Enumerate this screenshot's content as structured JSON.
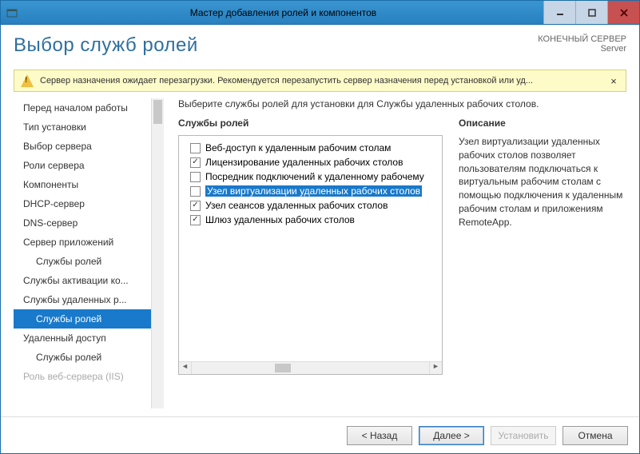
{
  "titlebar": {
    "title": "Мастер добавления ролей и компонентов"
  },
  "header": {
    "page_title": "Выбор служб ролей",
    "dest_label": "КОНЕЧНЫЙ СЕРВЕР",
    "dest_value": "Server"
  },
  "warning": {
    "text": "Сервер назначения ожидает перезагрузки. Рекомендуется перезапустить сервер назначения перед установкой или уд...",
    "close": "×"
  },
  "sidebar": {
    "items": [
      {
        "label": "Перед началом работы",
        "indent": false
      },
      {
        "label": "Тип установки",
        "indent": false
      },
      {
        "label": "Выбор сервера",
        "indent": false
      },
      {
        "label": "Роли сервера",
        "indent": false
      },
      {
        "label": "Компоненты",
        "indent": false
      },
      {
        "label": "DHCP-сервер",
        "indent": false
      },
      {
        "label": "DNS-сервер",
        "indent": false
      },
      {
        "label": "Сервер приложений",
        "indent": false
      },
      {
        "label": "Службы ролей",
        "indent": true
      },
      {
        "label": "Службы активации ко...",
        "indent": false
      },
      {
        "label": "Службы удаленных р...",
        "indent": false
      },
      {
        "label": "Службы ролей",
        "indent": true,
        "selected": true
      },
      {
        "label": "Удаленный доступ",
        "indent": false
      },
      {
        "label": "Службы ролей",
        "indent": true
      },
      {
        "label": "Роль веб-сервера (IIS)",
        "indent": false,
        "disabled": true
      }
    ]
  },
  "main": {
    "instruction": "Выберите службы ролей для установки для Службы удаленных рабочих столов.",
    "roles_title": "Службы ролей",
    "desc_title": "Описание",
    "roles": [
      {
        "label": "Веб-доступ к удаленным рабочим столам",
        "checked": false
      },
      {
        "label": "Лицензирование удаленных рабочих столов",
        "checked": true
      },
      {
        "label": "Посредник подключений к удаленному рабочему",
        "checked": false
      },
      {
        "label": "Узел виртуализации удаленных рабочих столов",
        "checked": false,
        "highlight": true
      },
      {
        "label": "Узел сеансов удаленных рабочих столов",
        "checked": true
      },
      {
        "label": "Шлюз удаленных рабочих столов",
        "checked": true
      }
    ],
    "description": "Узел виртуализации удаленных рабочих столов  позволяет пользователям подключаться к виртуальным рабочим столам с помощью подключения к удаленным рабочим столам и приложениям RemoteApp."
  },
  "footer": {
    "back": "< Назад",
    "next": "Далее >",
    "install": "Установить",
    "cancel": "Отмена"
  }
}
